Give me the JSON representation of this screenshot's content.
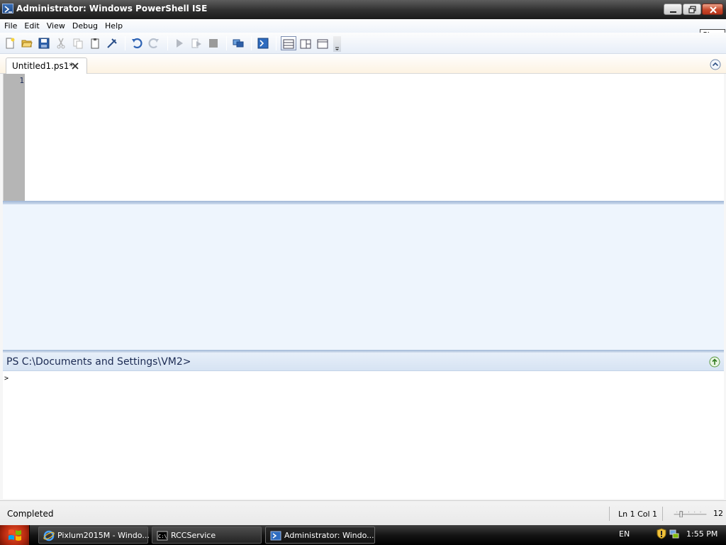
{
  "window": {
    "title": "Administrator: Windows PowerShell ISE",
    "tooltip": "Close"
  },
  "menu": {
    "items": [
      "File",
      "Edit",
      "View",
      "Debug",
      "Help"
    ]
  },
  "toolbar": {
    "icons": [
      "new-icon",
      "open-icon",
      "save-icon",
      "cut-icon",
      "copy-icon",
      "paste-icon",
      "clear-icon",
      "undo-icon",
      "redo-icon",
      "run-icon",
      "run-selection-icon",
      "stop-icon",
      "new-remote-tab-icon",
      "powershell-icon",
      "layout-top-icon",
      "layout-right-icon",
      "layout-max-icon"
    ]
  },
  "tabs": [
    {
      "label": "Untitled1.ps1*",
      "active": true
    }
  ],
  "editor": {
    "line_numbers": [
      "1"
    ],
    "content": ""
  },
  "command_pane": {
    "prompt": "PS C:\\Documents and Settings\\VM2>",
    "input_caret": ">"
  },
  "status": {
    "text": "Completed",
    "position": "Ln 1  Col 1",
    "zoom": "12"
  },
  "taskbar": {
    "buttons": [
      {
        "label": "Pixlum2015M - Windo...",
        "icon": "ie-icon"
      },
      {
        "label": "RCCService",
        "icon": "console-icon"
      },
      {
        "label": "Administrator: Windo...",
        "icon": "powershell-icon",
        "active": true
      }
    ],
    "language": "EN",
    "clock": "1:55 PM"
  },
  "colors": {
    "accent": "#1e4a8a",
    "output_bg": "#eef5fd",
    "gutter": "#b5b5b5",
    "start": "#c6391a"
  }
}
